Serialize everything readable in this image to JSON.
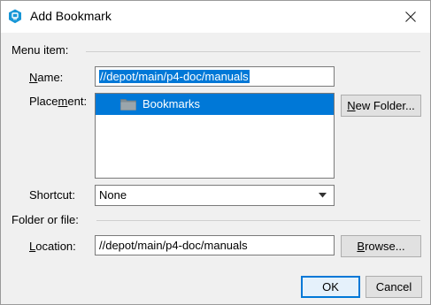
{
  "dialog": {
    "title": "Add Bookmark",
    "app_icon": "perforce-icon",
    "close_icon": "close-icon"
  },
  "menu_item": {
    "section_label": "Menu item:",
    "name": {
      "label_mnemonic": "N",
      "label_rest": "ame:",
      "value": "//depot/main/p4-doc/manuals"
    },
    "placement": {
      "label_pre": "Place",
      "label_mnemonic": "m",
      "label_post": "ent:",
      "tree_items": [
        {
          "label": "Bookmarks",
          "icon": "folder-icon",
          "selected": true
        }
      ]
    },
    "new_folder": {
      "label_mnemonic": "N",
      "label_rest": "ew Folder..."
    },
    "shortcut": {
      "label": "Shortcut:",
      "value": "None"
    }
  },
  "folder_or_file": {
    "section_label": "Folder or file:",
    "location": {
      "label_mnemonic": "L",
      "label_rest": "ocation:",
      "value": "//depot/main/p4-doc/manuals"
    },
    "browse": {
      "label_mnemonic": "B",
      "label_rest": "rowse..."
    }
  },
  "buttons": {
    "ok": "OK",
    "cancel": "Cancel"
  },
  "colors": {
    "accent": "#0078d7",
    "dialog_bg": "#f0f0f0"
  }
}
